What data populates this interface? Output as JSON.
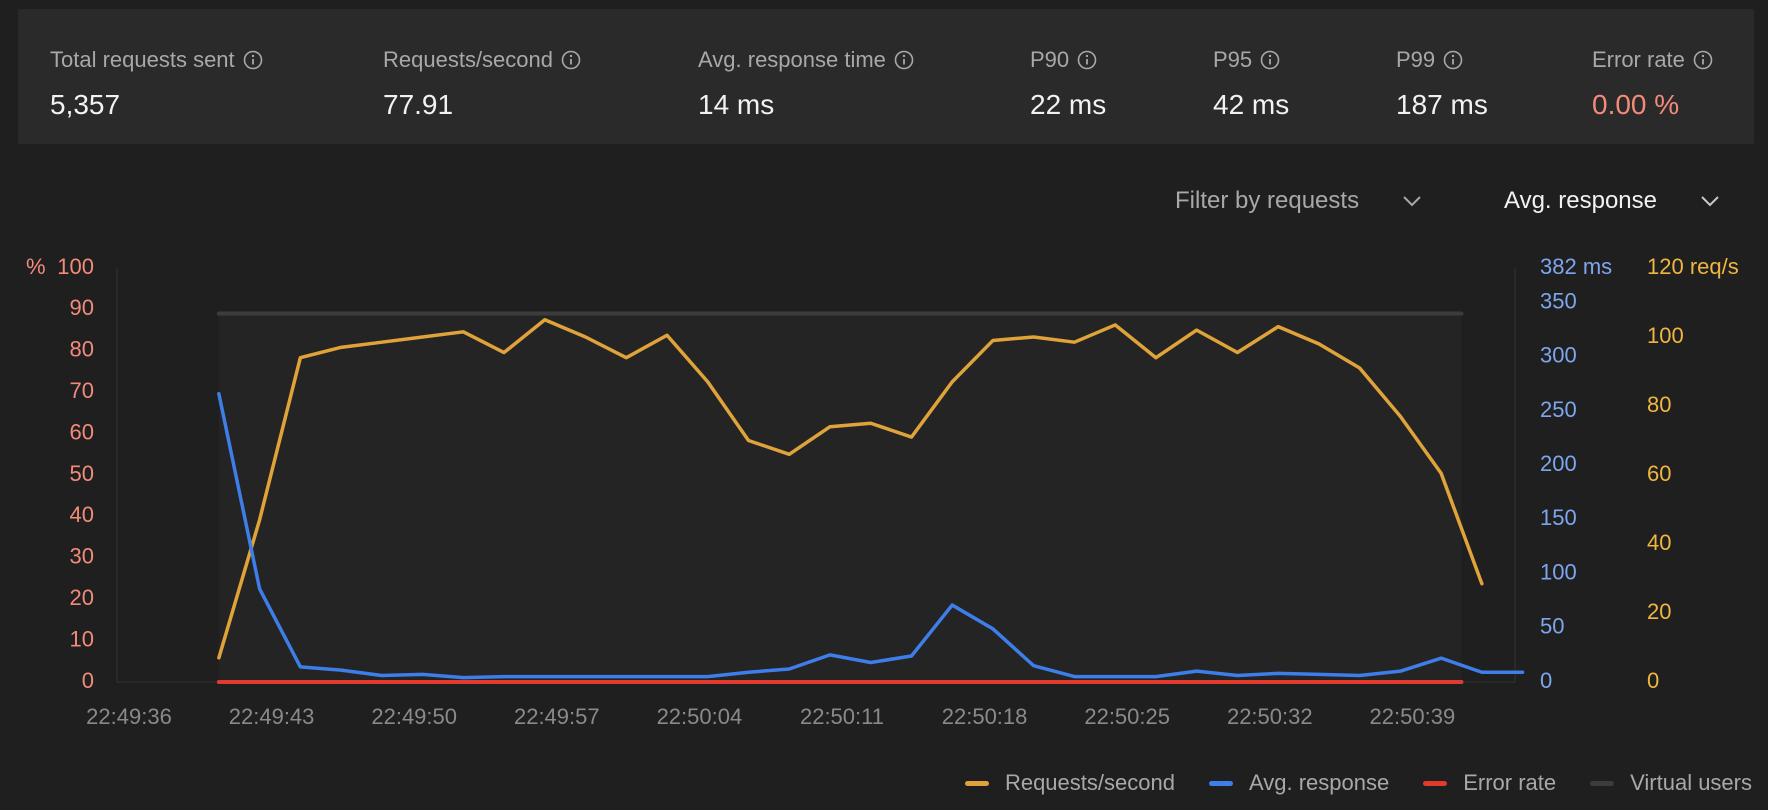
{
  "stats": [
    {
      "label": "Total requests sent",
      "value": "5,357"
    },
    {
      "label": "Requests/second",
      "value": "77.91"
    },
    {
      "label": "Avg. response time",
      "value": "14 ms"
    },
    {
      "label": "P90",
      "value": "22 ms"
    },
    {
      "label": "P95",
      "value": "42 ms"
    },
    {
      "label": "P99",
      "value": "187 ms"
    },
    {
      "label": "Error rate",
      "value": "0.00 %",
      "color": "#f28b7a"
    }
  ],
  "filters": {
    "requests_label": "Filter by requests",
    "metric_label": "Avg. response"
  },
  "colors": {
    "requests": "#e0a33a",
    "response": "#3d7ee8",
    "error": "#e23b2e",
    "virtual_users": "#3c3c3c",
    "left_axis": "#f28b7a",
    "ms_axis": "#7ea6ee",
    "reqs_axis": "#f0b640"
  },
  "legend": [
    {
      "key": "requests",
      "label": "Requests/second"
    },
    {
      "key": "response",
      "label": "Avg. response"
    },
    {
      "key": "error",
      "label": "Error rate"
    },
    {
      "key": "virtual_users",
      "label": "Virtual users"
    }
  ],
  "chart_data": {
    "type": "line",
    "x": [
      "22:49:36",
      "22:49:37",
      "22:49:38",
      "22:49:39",
      "22:49:40",
      "22:49:41",
      "22:49:42",
      "22:49:43",
      "22:49:44",
      "22:49:45",
      "22:49:46",
      "22:49:47",
      "22:49:48",
      "22:49:49",
      "22:49:50",
      "22:49:51",
      "22:49:52",
      "22:49:53",
      "22:49:54",
      "22:49:55",
      "22:49:56",
      "22:49:57",
      "22:49:58",
      "22:49:59",
      "22:50:00",
      "22:50:01",
      "22:50:02",
      "22:50:03",
      "22:50:04",
      "22:50:05",
      "22:50:06",
      "22:50:07",
      "22:50:08",
      "22:50:09",
      "22:50:10",
      "22:50:11",
      "22:50:12",
      "22:50:13",
      "22:50:14",
      "22:50:15",
      "22:50:16",
      "22:50:17",
      "22:50:18",
      "22:50:19",
      "22:50:20",
      "22:50:21",
      "22:50:22",
      "22:50:23",
      "22:50:24",
      "22:50:25",
      "22:50:26",
      "22:50:27",
      "22:50:28",
      "22:50:29",
      "22:50:30",
      "22:50:31",
      "22:50:32",
      "22:50:33",
      "22:50:34",
      "22:50:35",
      "22:50:36",
      "22:50:37",
      "22:50:38",
      "22:50:39",
      "22:50:40",
      "22:50:41",
      "22:50:42"
    ],
    "x_ticks": [
      "22:49:36",
      "22:49:43",
      "22:49:50",
      "22:49:57",
      "22:50:04",
      "22:50:11",
      "22:50:18",
      "22:50:25",
      "22:50:32",
      "22:50:39"
    ],
    "series": [
      {
        "name": "Requests/second",
        "key": "requests",
        "axis": "reqs",
        "start": "22:49:41",
        "values": [
          7,
          47,
          94,
          97,
          98.5,
          100,
          101.5,
          95.5,
          105,
          100,
          94,
          100.5,
          87,
          70,
          66,
          74,
          75,
          71,
          87,
          99,
          100,
          98.5,
          103.5,
          94,
          102,
          95.5,
          103,
          98,
          91,
          77,
          60.5,
          28.5
        ]
      },
      {
        "name": "Avg. response",
        "key": "response",
        "axis": "ms",
        "start": "22:49:41",
        "values": [
          266,
          86,
          14,
          11,
          6,
          7,
          4,
          5,
          5,
          5,
          5,
          5,
          5,
          9,
          12,
          25,
          18,
          24,
          71,
          49,
          15,
          5,
          5,
          5,
          10,
          6,
          8,
          7,
          6,
          10,
          22,
          9,
          9
        ]
      },
      {
        "name": "Error rate",
        "key": "error",
        "axis": "pct",
        "start": "22:49:41",
        "values": [
          0,
          0
        ]
      },
      {
        "name": "Virtual users",
        "key": "virtual_users",
        "axis": "pct",
        "start": "22:49:41",
        "values": [
          89,
          89
        ]
      }
    ],
    "error_end": "22:50:42",
    "vu_end": "22:50:42",
    "axes": {
      "pct": {
        "unit_label": "%",
        "ticks": [
          0,
          10,
          20,
          30,
          40,
          50,
          60,
          70,
          80,
          90,
          100
        ],
        "range": [
          0,
          100
        ]
      },
      "ms": {
        "max_label": "382 ms",
        "ticks": [
          0,
          50,
          100,
          150,
          200,
          250,
          300,
          350
        ],
        "range": [
          0,
          382
        ]
      },
      "reqs": {
        "max_label": "120 req/s",
        "ticks": [
          0,
          20,
          40,
          60,
          80,
          100
        ],
        "range": [
          0,
          120
        ]
      }
    }
  }
}
